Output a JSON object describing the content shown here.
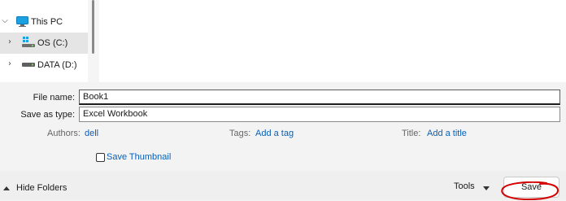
{
  "nav": {
    "items": [
      {
        "label": "This PC",
        "icon": "computer-icon",
        "expanded": true,
        "selected": false
      },
      {
        "label": "OS (C:)",
        "icon": "os-drive-icon",
        "expanded": false,
        "selected": true
      },
      {
        "label": "DATA (D:)",
        "icon": "drive-icon",
        "expanded": false,
        "selected": false
      }
    ]
  },
  "form": {
    "file_name_label": "File name:",
    "file_name_value": "Book1",
    "save_as_type_label": "Save as type:",
    "save_as_type_value": "Excel Workbook",
    "authors_label": "Authors:",
    "authors_value": "dell",
    "tags_label": "Tags:",
    "tags_value": "Add a tag",
    "title_label": "Title:",
    "title_value": "Add a title",
    "save_thumbnail_label": "Save Thumbnail",
    "save_thumbnail_checked": false
  },
  "footer": {
    "hide_folders_label": "Hide Folders",
    "tools_label": "Tools",
    "save_label": "Save"
  },
  "colors": {
    "link": "#0a5fb4",
    "annotation": "#d40000"
  }
}
